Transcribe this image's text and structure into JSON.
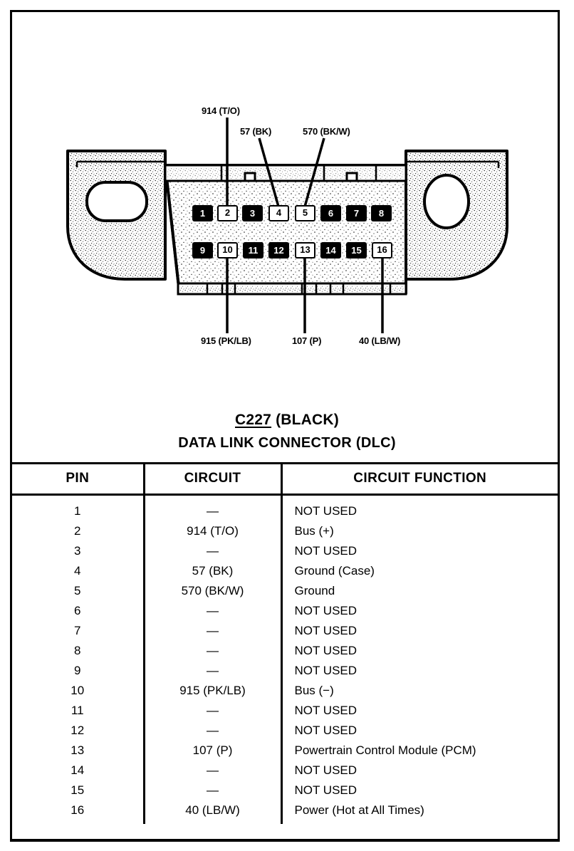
{
  "diagram": {
    "top_callouts": [
      {
        "text": "914 (T/O)",
        "pin": 2
      },
      {
        "text": "57 (BK)",
        "pin": 4
      },
      {
        "text": "570 (BK/W)",
        "pin": 5
      }
    ],
    "bottom_callouts": [
      {
        "text": "915 (PK/LB)",
        "pin": 10
      },
      {
        "text": "107 (P)",
        "pin": 13
      },
      {
        "text": "40 (LB/W)",
        "pin": 16
      }
    ],
    "pins_top_row": [
      "1",
      "2",
      "3",
      "4",
      "5",
      "6",
      "7",
      "8"
    ],
    "pins_bottom_row": [
      "9",
      "10",
      "11",
      "12",
      "13",
      "14",
      "15",
      "16"
    ],
    "highlighted_pins": [
      "2",
      "4",
      "5",
      "10",
      "13",
      "16"
    ]
  },
  "titles": {
    "connector_id": "C227",
    "connector_color": "(BLACK)",
    "connector_name": "DATA LINK CONNECTOR (DLC)"
  },
  "table": {
    "headers": {
      "pin": "PIN",
      "circuit": "CIRCUIT",
      "function": "CIRCUIT FUNCTION"
    },
    "rows": [
      {
        "pin": "1",
        "circuit": "—",
        "function": "NOT USED"
      },
      {
        "pin": "2",
        "circuit": "914 (T/O)",
        "function": "Bus (+)"
      },
      {
        "pin": "3",
        "circuit": "—",
        "function": "NOT USED"
      },
      {
        "pin": "4",
        "circuit": "57 (BK)",
        "function": "Ground (Case)"
      },
      {
        "pin": "5",
        "circuit": "570 (BK/W)",
        "function": "Ground"
      },
      {
        "pin": "6",
        "circuit": "—",
        "function": "NOT USED"
      },
      {
        "pin": "7",
        "circuit": "—",
        "function": "NOT USED"
      },
      {
        "pin": "8",
        "circuit": "—",
        "function": "NOT USED"
      },
      {
        "pin": "9",
        "circuit": "—",
        "function": "NOT USED"
      },
      {
        "pin": "10",
        "circuit": "915 (PK/LB)",
        "function": "Bus (−)"
      },
      {
        "pin": "11",
        "circuit": "—",
        "function": "NOT USED"
      },
      {
        "pin": "12",
        "circuit": "—",
        "function": "NOT USED"
      },
      {
        "pin": "13",
        "circuit": "107 (P)",
        "function": "Powertrain Control Module (PCM)"
      },
      {
        "pin": "14",
        "circuit": "—",
        "function": "NOT USED"
      },
      {
        "pin": "15",
        "circuit": "—",
        "function": "NOT USED"
      },
      {
        "pin": "16",
        "circuit": "40 (LB/W)",
        "function": "Power (Hot at All Times)"
      }
    ]
  },
  "colors": {
    "ink": "#000000",
    "paper": "#ffffff"
  }
}
